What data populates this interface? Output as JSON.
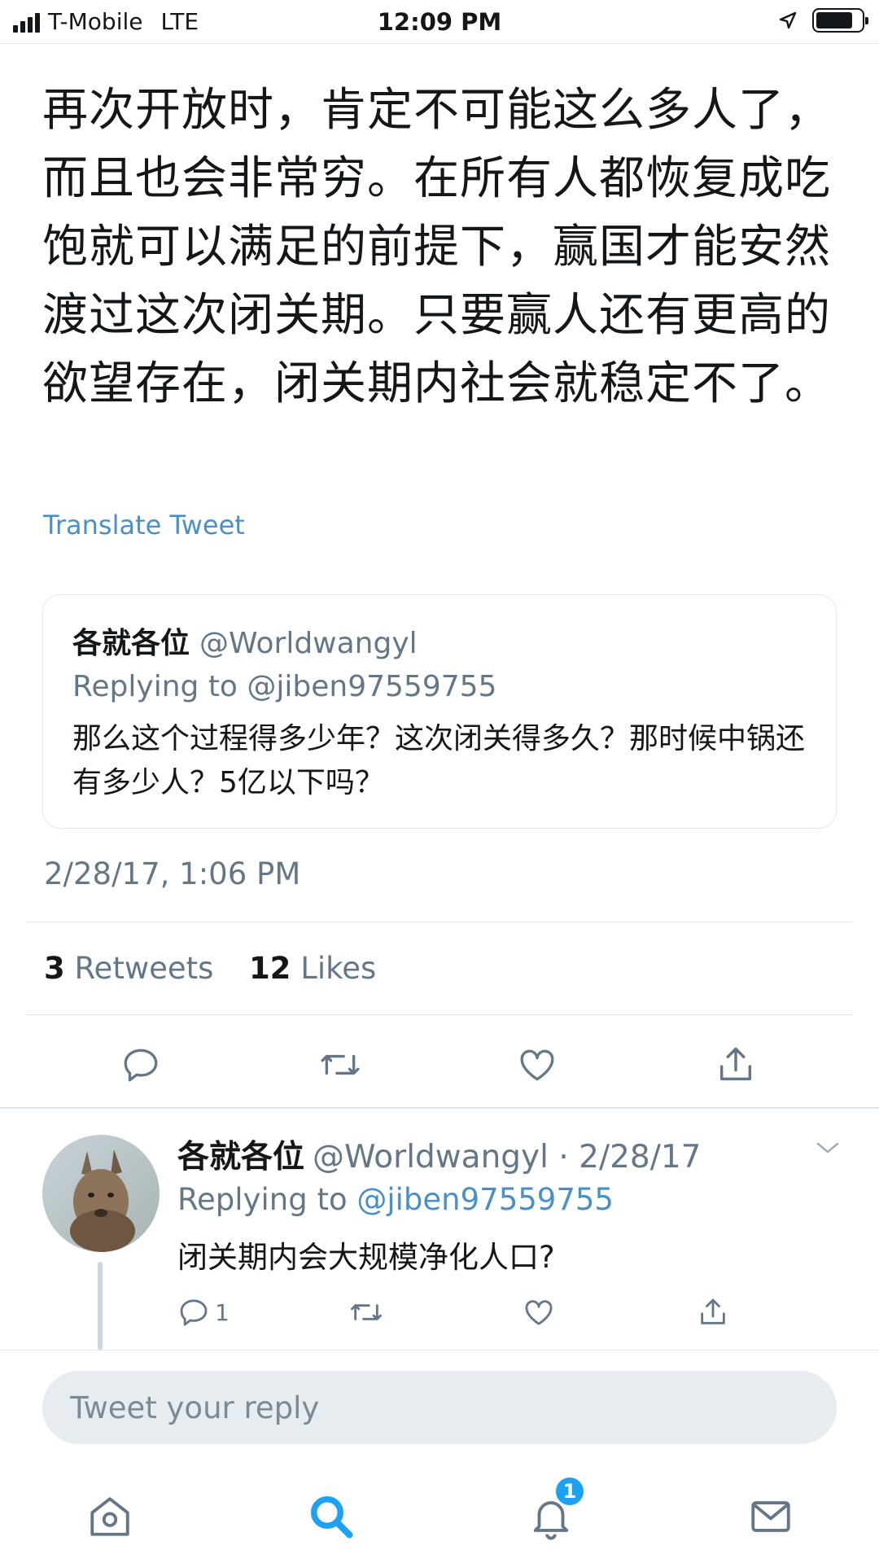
{
  "status_bar": {
    "carrier": "T-Mobile",
    "network": "LTE",
    "time": "12:09 PM"
  },
  "tweet": {
    "text": "再次开放时，肯定不可能这么多人了，而且也会非常穷。在所有人都恢复成吃饱就可以满足的前提下，赢国才能安然渡过这次闭关期。只要赢人还有更高的欲望存在，闭关期内社会就稳定不了。",
    "translate_label": "Translate Tweet",
    "timestamp": "2/28/17, 1:06 PM",
    "retweets_count": "3",
    "retweets_label": "Retweets",
    "likes_count": "12",
    "likes_label": "Likes"
  },
  "quoted_tweet": {
    "name": "各就各位",
    "handle": "@Worldwangyl",
    "replying_to": "Replying to @jiben97559755",
    "text": "那么这个过程得多少年？这次闭关得多久？那时候中锅还有多少人？5亿以下吗？"
  },
  "reply_tweet": {
    "name": "各就各位",
    "handle_date": "@Worldwangyl · 2/28/17",
    "replying_prefix": "Replying to",
    "replying_handle": "@jiben97559755",
    "text": "闭关期内会大规模净化人口?",
    "reply_count": "1"
  },
  "composer": {
    "placeholder": "Tweet your reply"
  },
  "tab_bar": {
    "notifications_badge": "1"
  },
  "colors": {
    "accent": "#1da1f2",
    "link": "#4a90c7",
    "secondary_text": "#657786",
    "divider": "#e1e8ed"
  }
}
